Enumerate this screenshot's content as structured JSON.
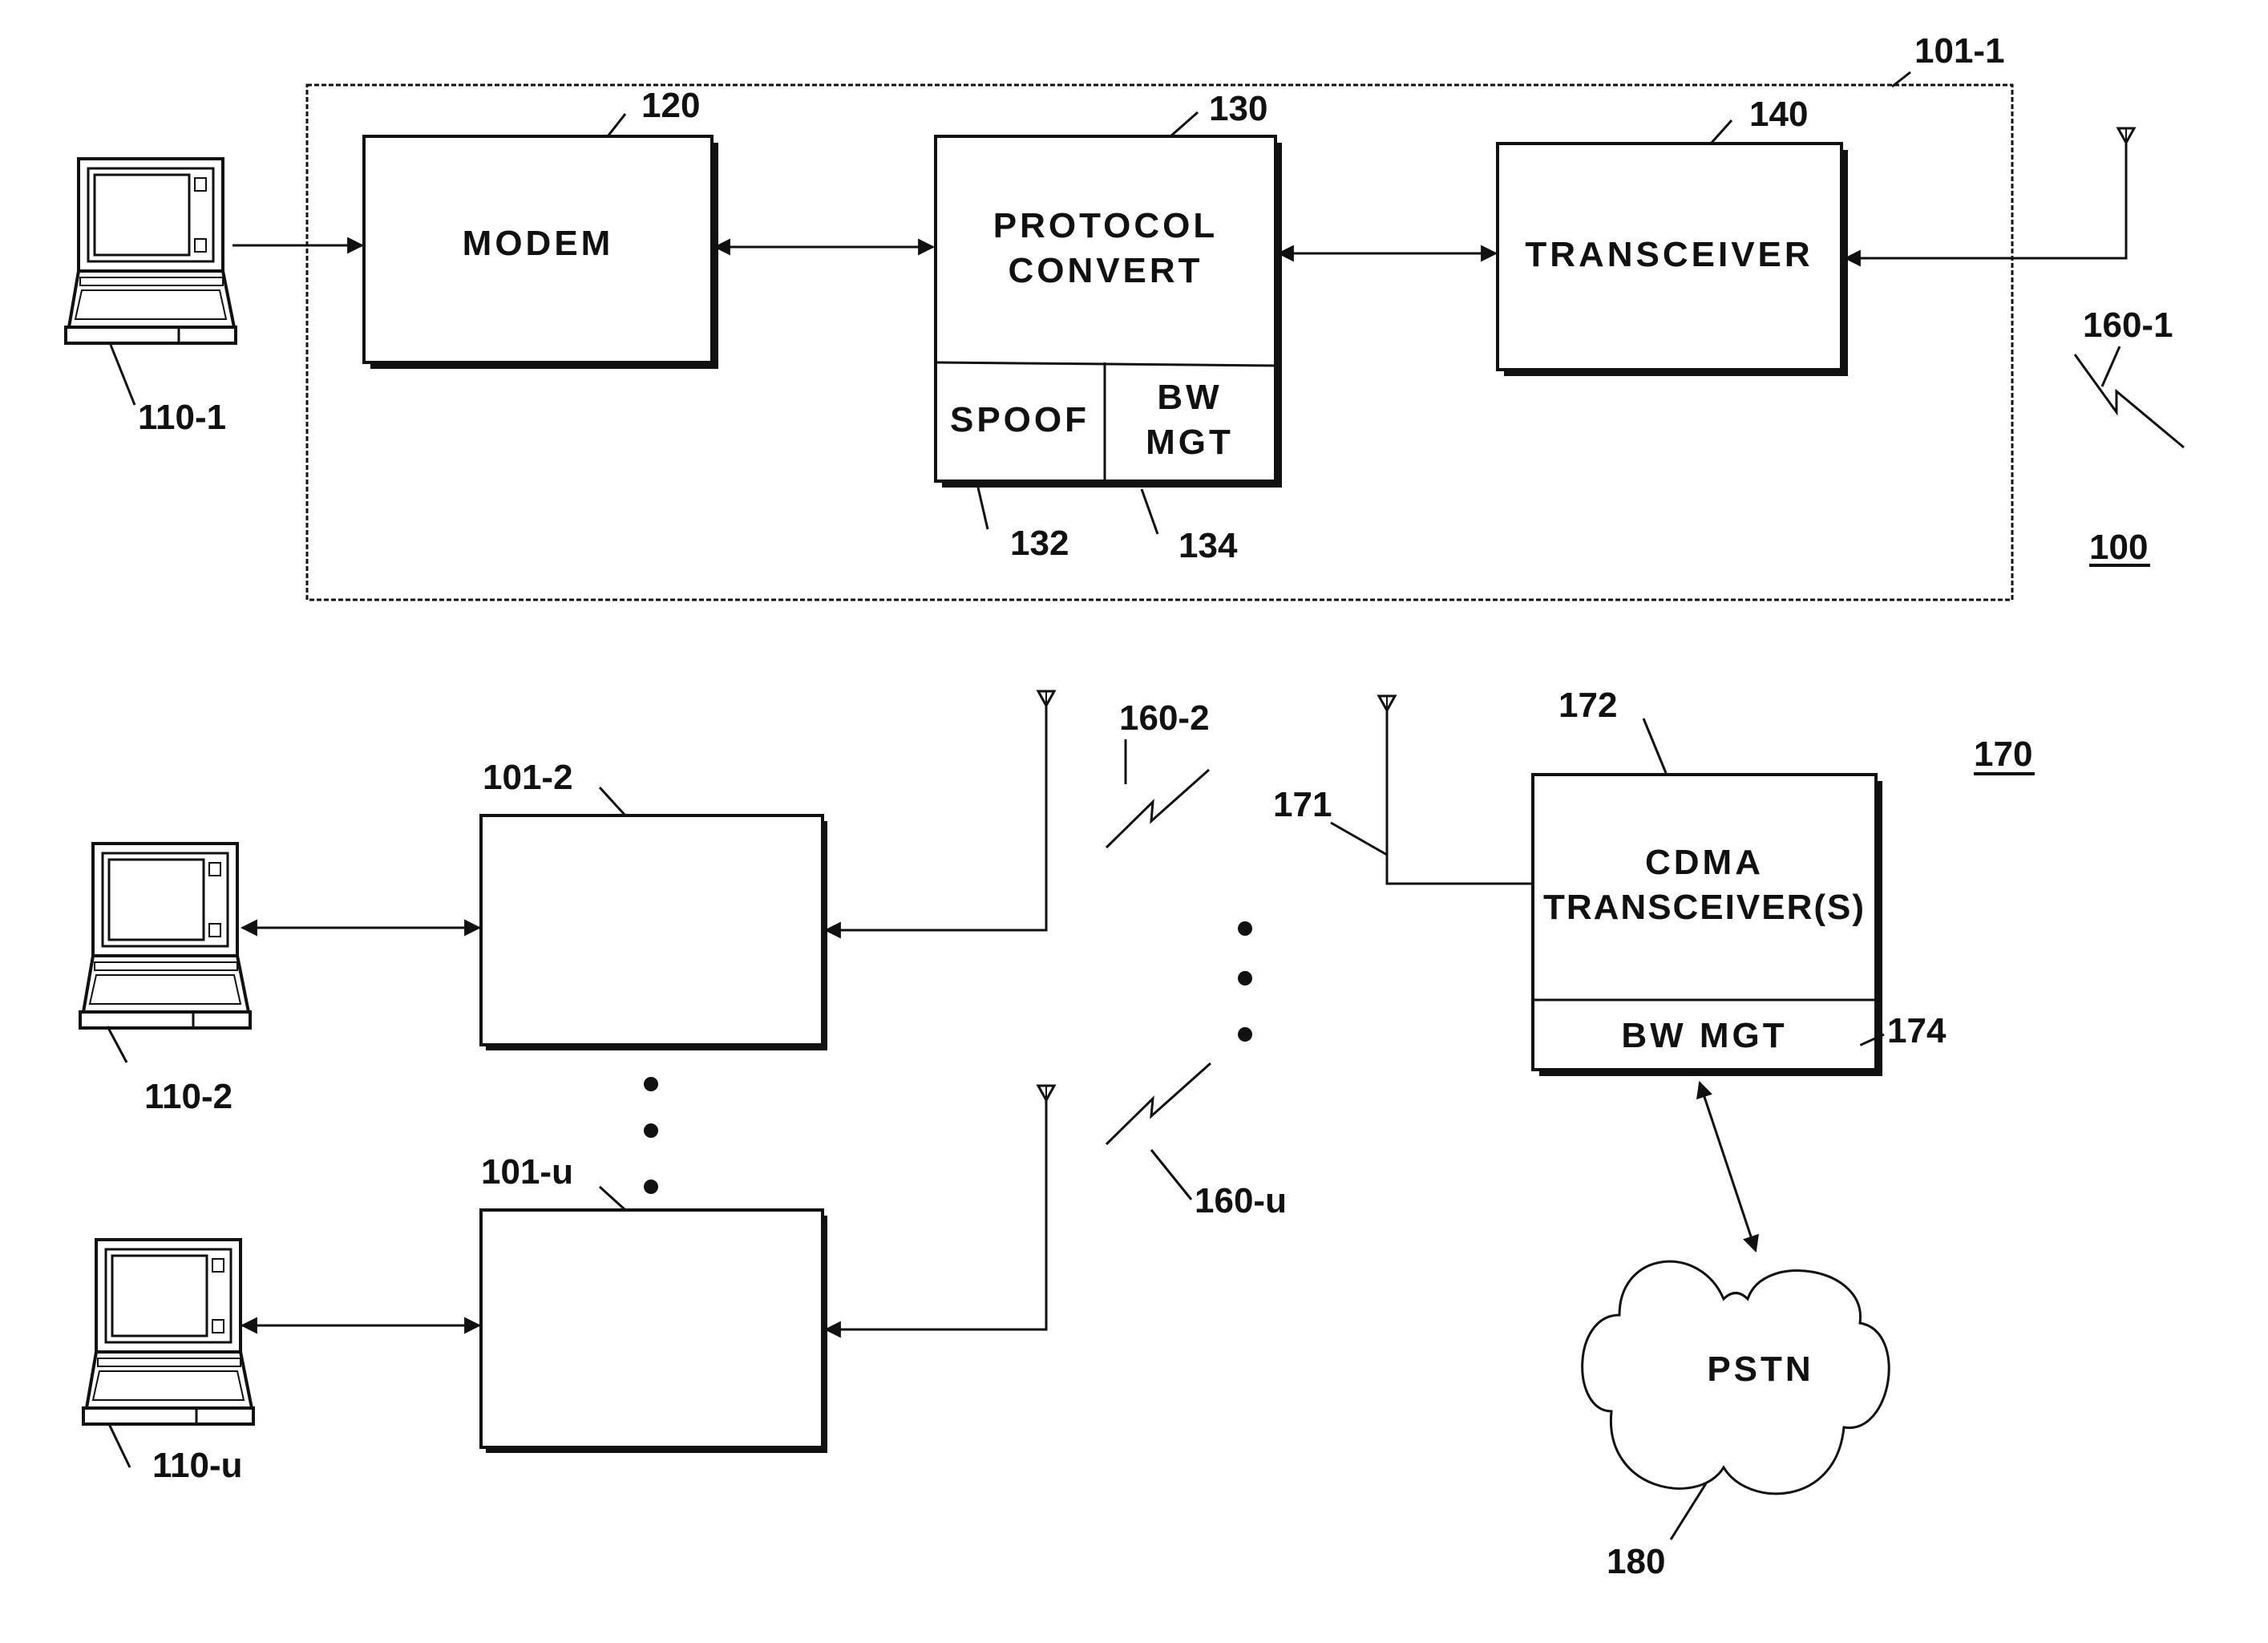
{
  "diagram": {
    "figure_ref": "100",
    "subscriber_unit_1": {
      "ref": "101-1",
      "modem": {
        "ref": "120",
        "label": "MODEM"
      },
      "protocol_convert": {
        "ref": "130",
        "label_line1": "PROTOCOL",
        "label_line2": "CONVERT",
        "spoof": {
          "ref": "132",
          "label": "SPOOF"
        },
        "bw_mgt": {
          "ref": "134",
          "label_line1": "BW",
          "label_line2": "MGT"
        }
      },
      "transceiver": {
        "ref": "140",
        "label": "TRANSCEIVER"
      },
      "laptop_ref": "110-1",
      "link_ref": "160-1"
    },
    "subscriber_unit_2": {
      "ref": "101-2",
      "laptop_ref": "110-2",
      "link_ref": "160-2"
    },
    "subscriber_unit_u": {
      "ref": "101-u",
      "laptop_ref": "110-u",
      "link_ref": "160-u"
    },
    "base_station": {
      "ref": "170",
      "antenna_ref": "171",
      "cdma": {
        "ref": "172",
        "label_line1": "CDMA",
        "label_line2": "TRANSCEIVER(S)"
      },
      "bw_mgt": {
        "ref": "174",
        "label": "BW MGT"
      }
    },
    "pstn": {
      "ref": "180",
      "label": "PSTN"
    }
  }
}
